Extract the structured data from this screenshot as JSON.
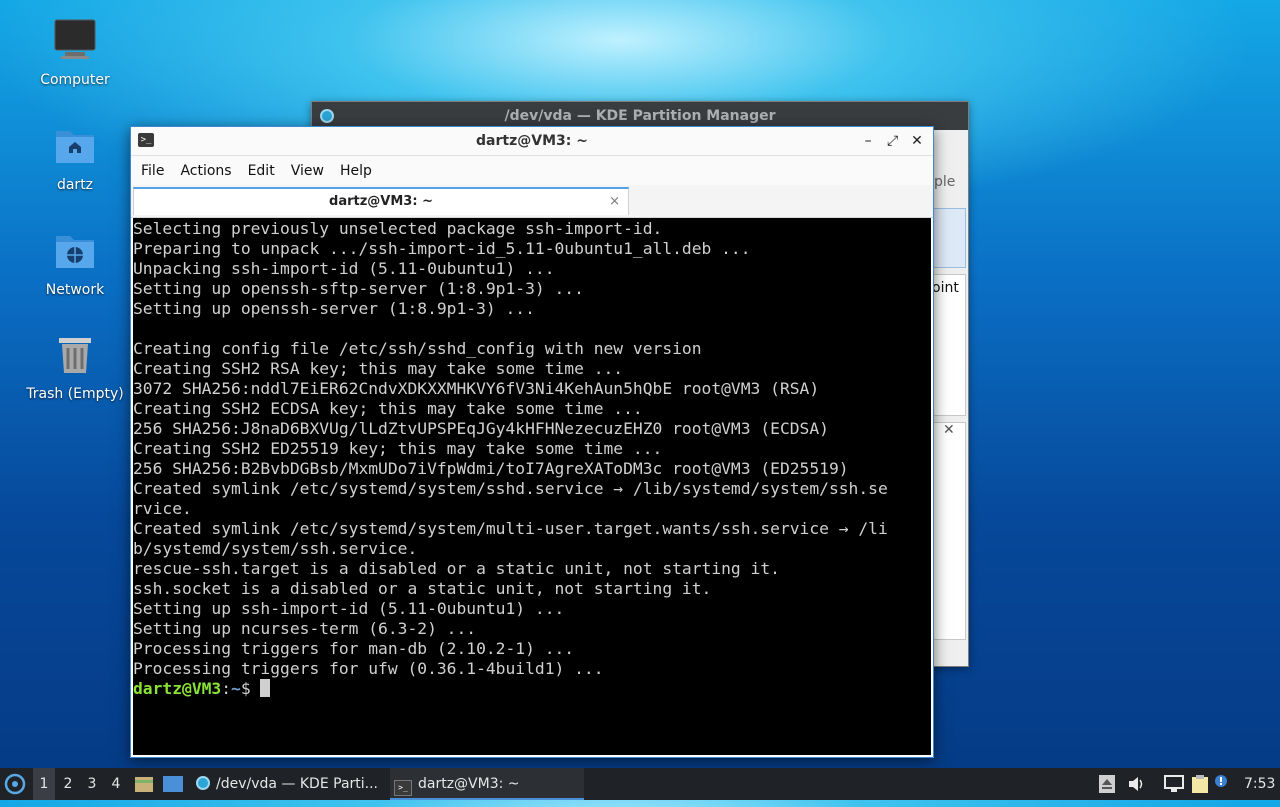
{
  "desktop": {
    "icons": [
      {
        "label": "Computer"
      },
      {
        "label": "dartz"
      },
      {
        "label": "Network"
      },
      {
        "label": "Trash (Empty)"
      }
    ]
  },
  "partition_manager": {
    "title": "/dev/vda — KDE Partition Manager",
    "fragments": [
      "ple",
      "oint"
    ]
  },
  "terminal": {
    "title": "dartz@VM3: ~",
    "window_controls": [
      "–",
      "⤢",
      "✕"
    ],
    "menu": [
      "File",
      "Actions",
      "Edit",
      "View",
      "Help"
    ],
    "tab": {
      "label": "dartz@VM3: ~",
      "close": "×"
    },
    "lines": [
      "Selecting previously unselected package ssh-import-id.",
      "Preparing to unpack .../ssh-import-id_5.11-0ubuntu1_all.deb ...",
      "Unpacking ssh-import-id (5.11-0ubuntu1) ...",
      "Setting up openssh-sftp-server (1:8.9p1-3) ...",
      "Setting up openssh-server (1:8.9p1-3) ...",
      "",
      "Creating config file /etc/ssh/sshd_config with new version",
      "Creating SSH2 RSA key; this may take some time ...",
      "3072 SHA256:nddl7EiER62CndvXDKXXMHKVY6fV3Ni4KehAun5hQbE root@VM3 (RSA)",
      "Creating SSH2 ECDSA key; this may take some time ...",
      "256 SHA256:J8naD6BXVUg/lLdZtvUPSPEqJGy4kHFHNezecuzEHZ0 root@VM3 (ECDSA)",
      "Creating SSH2 ED25519 key; this may take some time ...",
      "256 SHA256:B2BvbDGBsb/MxmUDo7iVfpWdmi/toI7AgreXAToDM3c root@VM3 (ED25519)",
      "Created symlink /etc/systemd/system/sshd.service → /lib/systemd/system/ssh.se",
      "rvice.",
      "Created symlink /etc/systemd/system/multi-user.target.wants/ssh.service → /li",
      "b/systemd/system/ssh.service.",
      "rescue-ssh.target is a disabled or a static unit, not starting it.",
      "ssh.socket is a disabled or a static unit, not starting it.",
      "Setting up ssh-import-id (5.11-0ubuntu1) ...",
      "Setting up ncurses-term (6.3-2) ...",
      "Processing triggers for man-db (2.10.2-1) ...",
      "Processing triggers for ufw (0.36.1-4build1) ..."
    ],
    "prompt": {
      "user": "dartz@VM3",
      "sep": ":",
      "path": "~",
      "symbol": "$ "
    }
  },
  "taskbar": {
    "workspaces": [
      "1",
      "2",
      "3",
      "4"
    ],
    "active_workspace": "1",
    "tasks": [
      {
        "label": "/dev/vda — KDE Parti...",
        "icon": "kde-partition-icon"
      },
      {
        "label": "dartz@VM3: ~",
        "icon": "terminal-icon"
      }
    ],
    "clock": "7:53",
    "colors": {
      "accent": "#4a90d9",
      "panel": "#1f2226"
    }
  }
}
